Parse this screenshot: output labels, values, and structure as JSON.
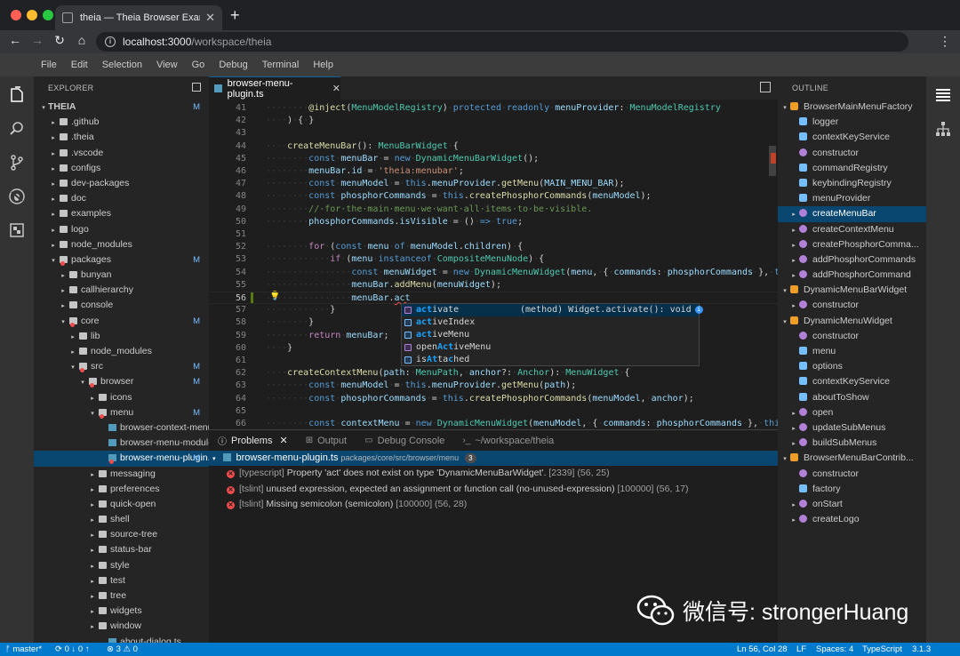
{
  "browser": {
    "tab_title": "theia — Theia Browser Example",
    "tab_close": "✕",
    "new_tab": "+",
    "url_host": "localhost:3000",
    "url_path": "/workspace/theia"
  },
  "menubar": [
    "File",
    "Edit",
    "Selection",
    "View",
    "Go",
    "Debug",
    "Terminal",
    "Help"
  ],
  "explorer": {
    "title": "EXPLORER",
    "items": [
      {
        "label": "THEIA",
        "depth": 0,
        "open": true,
        "badge": "M",
        "root": true
      },
      {
        "label": ".github",
        "depth": 1,
        "open": false
      },
      {
        "label": ".theia",
        "depth": 1,
        "open": false
      },
      {
        "label": ".vscode",
        "depth": 1,
        "open": false
      },
      {
        "label": "configs",
        "depth": 1,
        "open": false
      },
      {
        "label": "dev-packages",
        "depth": 1,
        "open": false
      },
      {
        "label": "doc",
        "depth": 1,
        "open": false
      },
      {
        "label": "examples",
        "depth": 1,
        "open": false
      },
      {
        "label": "logo",
        "depth": 1,
        "open": false
      },
      {
        "label": "node_modules",
        "depth": 1,
        "open": false
      },
      {
        "label": "packages",
        "depth": 1,
        "open": true,
        "badge": "M",
        "err": true
      },
      {
        "label": "bunyan",
        "depth": 2,
        "open": false
      },
      {
        "label": "callhierarchy",
        "depth": 2,
        "open": false
      },
      {
        "label": "console",
        "depth": 2,
        "open": false
      },
      {
        "label": "core",
        "depth": 2,
        "open": true,
        "badge": "M",
        "err": true
      },
      {
        "label": "lib",
        "depth": 3,
        "open": false
      },
      {
        "label": "node_modules",
        "depth": 3,
        "open": false
      },
      {
        "label": "src",
        "depth": 3,
        "open": true,
        "badge": "M",
        "err": true
      },
      {
        "label": "browser",
        "depth": 4,
        "open": true,
        "badge": "M",
        "err": true
      },
      {
        "label": "icons",
        "depth": 5,
        "open": false
      },
      {
        "label": "menu",
        "depth": 5,
        "open": true,
        "badge": "M",
        "err": true
      },
      {
        "label": "browser-context-menu-r...",
        "depth": 6,
        "file": true
      },
      {
        "label": "browser-menu-module.ts",
        "depth": 6,
        "file": true
      },
      {
        "label": "browser-menu-plugin.ts",
        "depth": 6,
        "file": true,
        "badge": "M",
        "sel": true,
        "err": true
      },
      {
        "label": "messaging",
        "depth": 5,
        "open": false
      },
      {
        "label": "preferences",
        "depth": 5,
        "open": false
      },
      {
        "label": "quick-open",
        "depth": 5,
        "open": false
      },
      {
        "label": "shell",
        "depth": 5,
        "open": false
      },
      {
        "label": "source-tree",
        "depth": 5,
        "open": false
      },
      {
        "label": "status-bar",
        "depth": 5,
        "open": false
      },
      {
        "label": "style",
        "depth": 5,
        "open": false
      },
      {
        "label": "test",
        "depth": 5,
        "open": false
      },
      {
        "label": "tree",
        "depth": 5,
        "open": false
      },
      {
        "label": "widgets",
        "depth": 5,
        "open": false
      },
      {
        "label": "window",
        "depth": 5,
        "open": false
      },
      {
        "label": "about-dialog.ts",
        "depth": 6,
        "file": true
      }
    ]
  },
  "editor": {
    "tab_label": "browser-menu-plugin.ts",
    "tab_close": "✕",
    "lines": [
      {
        "n": "41",
        "html": "<span class='ws'>········</span><span class='fn'>@inject</span>(<span class='ty'>MenuModelRegistry</span>)<span class='ws'>·</span><span class='kw'>protected</span><span class='ws'>·</span><span class='kw'>readonly</span><span class='ws'>·</span><span class='vr'>menuProvider</span>:<span class='ws'>·</span><span class='ty'>MenuModelRegistry</span>"
      },
      {
        "n": "42",
        "html": "<span class='ws'>····</span>)<span class='ws'>·</span>{<span class='ws'>·</span>}"
      },
      {
        "n": "43",
        "html": ""
      },
      {
        "n": "44",
        "html": "<span class='ws'>····</span><span class='fn'>createMenuBar</span>():<span class='ws'>·</span><span class='ty'>MenuBarWidget</span><span class='ws'>·</span>{"
      },
      {
        "n": "45",
        "html": "<span class='ws'>········</span><span class='kw'>const</span><span class='ws'>·</span><span class='vr'>menuBar</span><span class='ws'>·</span>=<span class='ws'>·</span><span class='kw'>new</span><span class='ws'>·</span><span class='ty'>DynamicMenuBarWidget</span>();"
      },
      {
        "n": "46",
        "html": "<span class='ws'>········</span><span class='vr'>menuBar</span>.<span class='vr'>id</span><span class='ws'>·</span>=<span class='ws'>·</span><span class='st'>'theia:menubar'</span>;"
      },
      {
        "n": "47",
        "html": "<span class='ws'>········</span><span class='kw'>const</span><span class='ws'>·</span><span class='vr'>menuModel</span><span class='ws'>·</span>=<span class='ws'>·</span><span class='kw'>this</span>.<span class='vr'>menuProvider</span>.<span class='fn'>getMenu</span>(<span class='vr'>MAIN_MENU_BAR</span>);"
      },
      {
        "n": "48",
        "html": "<span class='ws'>········</span><span class='kw'>const</span><span class='ws'>·</span><span class='vr'>phosphorCommands</span><span class='ws'>·</span>=<span class='ws'>·</span><span class='kw'>this</span>.<span class='fn'>createPhosphorCommands</span>(<span class='vr'>menuModel</span>);"
      },
      {
        "n": "49",
        "html": "<span class='ws'>········</span><span class='cm'>//·for·the·main·menu·we·want·all·items·to·be·visible.</span>"
      },
      {
        "n": "50",
        "html": "<span class='ws'>········</span><span class='vr'>phosphorCommands</span>.<span class='vr'>isVisible</span><span class='ws'>·</span>=<span class='ws'>·</span>()<span class='ws'>·</span><span class='kw'>=&gt;</span><span class='ws'>·</span><span class='kw'>true</span>;"
      },
      {
        "n": "51",
        "html": ""
      },
      {
        "n": "52",
        "html": "<span class='ws'>········</span><span class='ctl'>for</span><span class='ws'>·</span>(<span class='kw'>const</span><span class='ws'>·</span><span class='vr'>menu</span><span class='ws'>·</span><span class='kw'>of</span><span class='ws'>·</span><span class='vr'>menuModel</span>.<span class='vr'>children</span>)<span class='ws'>·</span>{"
      },
      {
        "n": "53",
        "html": "<span class='ws'>············</span><span class='ctl'>if</span><span class='ws'>·</span>(<span class='vr'>menu</span><span class='ws'>·</span><span class='kw'>instanceof</span><span class='ws'>·</span><span class='ty'>CompositeMenuNode</span>)<span class='ws'>·</span>{"
      },
      {
        "n": "54",
        "html": "<span class='ws'>················</span><span class='kw'>const</span><span class='ws'>·</span><span class='vr'>menuWidget</span><span class='ws'>·</span>=<span class='ws'>·</span><span class='kw'>new</span><span class='ws'>·</span><span class='ty'>DynamicMenuWidget</span>(<span class='vr'>menu</span>,<span class='ws'>·</span>{<span class='ws'>·</span><span class='vr'>commands</span>:<span class='ws'>·</span><span class='vr'>phosphorCommands</span><span class='ws'>·</span>},<span class='ws'>·</span><span class='kw'>this</span>.<span class='vr'>co</span>"
      },
      {
        "n": "55",
        "html": "<span class='ws'>················</span><span class='vr'>menuBar</span>.<span class='fn'>addMenu</span>(<span class='vr'>menuWidget</span>);"
      },
      {
        "n": "56",
        "html": "<span class='ws'>················</span><span class='vr'>menuBar</span>.<span class='vr' style='text-decoration: underline wavy #f14c4c;'>act</span>",
        "cur": true
      },
      {
        "n": "57",
        "html": "<span class='ws'>············</span>}"
      },
      {
        "n": "58",
        "html": "<span class='ws'>········</span>}"
      },
      {
        "n": "59",
        "html": "<span class='ws'>········</span><span class='ctl'>return</span><span class='ws'>·</span><span class='vr'>menuBar</span>;"
      },
      {
        "n": "60",
        "html": "<span class='ws'>····</span>}"
      },
      {
        "n": "61",
        "html": ""
      },
      {
        "n": "62",
        "html": "<span class='ws'>····</span><span class='fn'>createContextMenu</span>(<span class='vr'>path</span>:<span class='ws'>·</span><span class='ty'>MenuPath</span>,<span class='ws'>·</span><span class='vr'>anchor</span>?:<span class='ws'>·</span><span class='ty'>Anchor</span>):<span class='ws'>·</span><span class='ty'>MenuWidget</span><span class='ws'>·</span>{"
      },
      {
        "n": "63",
        "html": "<span class='ws'>········</span><span class='kw'>const</span><span class='ws'>·</span><span class='vr'>menuModel</span><span class='ws'>·</span>=<span class='ws'>·</span><span class='kw'>this</span>.<span class='vr'>menuProvider</span>.<span class='fn'>getMenu</span>(<span class='vr'>path</span>);"
      },
      {
        "n": "64",
        "html": "<span class='ws'>········</span><span class='kw'>const</span><span class='ws'>·</span><span class='vr'>phosphorCommands</span><span class='ws'>·</span>=<span class='ws'>·</span><span class='kw'>this</span>.<span class='fn'>createPhosphorCommands</span>(<span class='vr'>menuModel</span>,<span class='ws'>·</span><span class='vr'>anchor</span>);"
      },
      {
        "n": "65",
        "html": ""
      },
      {
        "n": "66",
        "html": "<span class='ws'>········</span><span class='kw'>const</span><span class='ws'>·</span><span class='vr'>contextMenu</span><span class='ws'>·</span>=<span class='ws'>·</span><span class='kw'>new</span><span class='ws'>·</span><span class='ty'>DynamicMenuWidget</span>(<span class='vr'>menuModel</span>,<span class='ws'>·</span>{<span class='ws'>·</span><span class='vr'>commands</span>:<span class='ws'>·</span><span class='vr'>phosphorCommands</span><span class='ws'>·</span>},<span class='ws'>·</span><span class='kw'>this</span>.<span class='vr'>cont</span>"
      }
    ]
  },
  "suggest": {
    "items": [
      {
        "pre": "",
        "hl": "act",
        "post": "ivate",
        "kind": "method",
        "detail": "(method) Widget.activate(): void",
        "sel": true
      },
      {
        "pre": "",
        "hl": "act",
        "post": "iveIndex",
        "kind": "field"
      },
      {
        "pre": "",
        "hl": "act",
        "post": "iveMenu",
        "kind": "field"
      },
      {
        "pre": "open",
        "hl": "Act",
        "post": "iveMenu",
        "kind": "method"
      },
      {
        "pre": "is",
        "hl": "At",
        "post": "ta",
        "hl2": "c",
        "post2": "hed",
        "kind": "field"
      }
    ]
  },
  "panel": {
    "tabs": [
      {
        "label": "Problems",
        "icon": "ⓘ",
        "close": "✕",
        "active": true
      },
      {
        "label": "Output",
        "icon": "⊞"
      },
      {
        "label": "Debug Console",
        "icon": "▭"
      },
      {
        "label": "~/workspace/theia",
        "icon": "›_"
      }
    ],
    "file": {
      "name": "browser-menu-plugin.ts",
      "path": "packages/core/src/browser/menu",
      "count": "3"
    },
    "problems": [
      {
        "source": "[typescript]",
        "message": "Property 'act' does not exist on type 'DynamicMenuBarWidget'.",
        "location": "[2339] (56, 25)"
      },
      {
        "source": "[tslint]",
        "message": "unused expression, expected an assignment or function call (no-unused-expression)",
        "location": "[100000] (56, 17)"
      },
      {
        "source": "[tslint]",
        "message": "Missing semicolon (semicolon)",
        "location": "[100000] (56, 28)"
      }
    ]
  },
  "outline": {
    "title": "OUTLINE",
    "items": [
      {
        "label": "BrowserMainMenuFactory",
        "kind": "cls",
        "depth": 0,
        "tw": "▾"
      },
      {
        "label": "logger",
        "kind": "prop",
        "depth": 1
      },
      {
        "label": "contextKeyService",
        "kind": "prop",
        "depth": 1
      },
      {
        "label": "constructor",
        "kind": "meth",
        "depth": 1
      },
      {
        "label": "commandRegistry",
        "kind": "prop",
        "depth": 1
      },
      {
        "label": "keybindingRegistry",
        "kind": "prop",
        "depth": 1
      },
      {
        "label": "menuProvider",
        "kind": "prop",
        "depth": 1
      },
      {
        "label": "createMenuBar",
        "kind": "meth",
        "depth": 1,
        "tw": "▸",
        "sel": true
      },
      {
        "label": "createContextMenu",
        "kind": "meth",
        "depth": 1,
        "tw": "▸"
      },
      {
        "label": "createPhosphorComma...",
        "kind": "meth",
        "depth": 1,
        "tw": "▸"
      },
      {
        "label": "addPhosphorCommands",
        "kind": "meth",
        "depth": 1,
        "tw": "▸"
      },
      {
        "label": "addPhosphorCommand",
        "kind": "meth",
        "depth": 1,
        "tw": "▸"
      },
      {
        "label": "DynamicMenuBarWidget",
        "kind": "cls",
        "depth": 0,
        "tw": "▾"
      },
      {
        "label": "constructor",
        "kind": "meth",
        "depth": 1,
        "tw": "▸"
      },
      {
        "label": "DynamicMenuWidget",
        "kind": "cls",
        "depth": 0,
        "tw": "▾"
      },
      {
        "label": "constructor",
        "kind": "meth",
        "depth": 1
      },
      {
        "label": "menu",
        "kind": "prop",
        "depth": 1
      },
      {
        "label": "options",
        "kind": "prop",
        "depth": 1
      },
      {
        "label": "contextKeyService",
        "kind": "prop",
        "depth": 1
      },
      {
        "label": "aboutToShow",
        "kind": "prop",
        "depth": 1
      },
      {
        "label": "open",
        "kind": "meth",
        "depth": 1,
        "tw": "▸"
      },
      {
        "label": "updateSubMenus",
        "kind": "meth",
        "depth": 1,
        "tw": "▸"
      },
      {
        "label": "buildSubMenus",
        "kind": "meth",
        "depth": 1,
        "tw": "▸"
      },
      {
        "label": "BrowserMenuBarContrib...",
        "kind": "cls",
        "depth": 0,
        "tw": "▾"
      },
      {
        "label": "constructor",
        "kind": "meth",
        "depth": 1
      },
      {
        "label": "factory",
        "kind": "prop",
        "depth": 1
      },
      {
        "label": "onStart",
        "kind": "meth",
        "depth": 1,
        "tw": "▸"
      },
      {
        "label": "createLogo",
        "kind": "meth",
        "depth": 1,
        "tw": "▸"
      }
    ]
  },
  "status": {
    "branch": "ᚠ master*",
    "sync": "⟳ 0 ↓ 0 ↑",
    "problems": "⊗ 3 ⚠ 0",
    "position": "Ln 56, Col 28",
    "eol": "LF",
    "indent": "Spaces: 4",
    "language": "TypeScript",
    "version": "3.1.3"
  },
  "watermark": {
    "text": "微信号: strongerHuang"
  },
  "colors": {
    "accent": "#007acc",
    "selection": "#094771",
    "error": "#f14c4c",
    "modified": "#75beff"
  }
}
